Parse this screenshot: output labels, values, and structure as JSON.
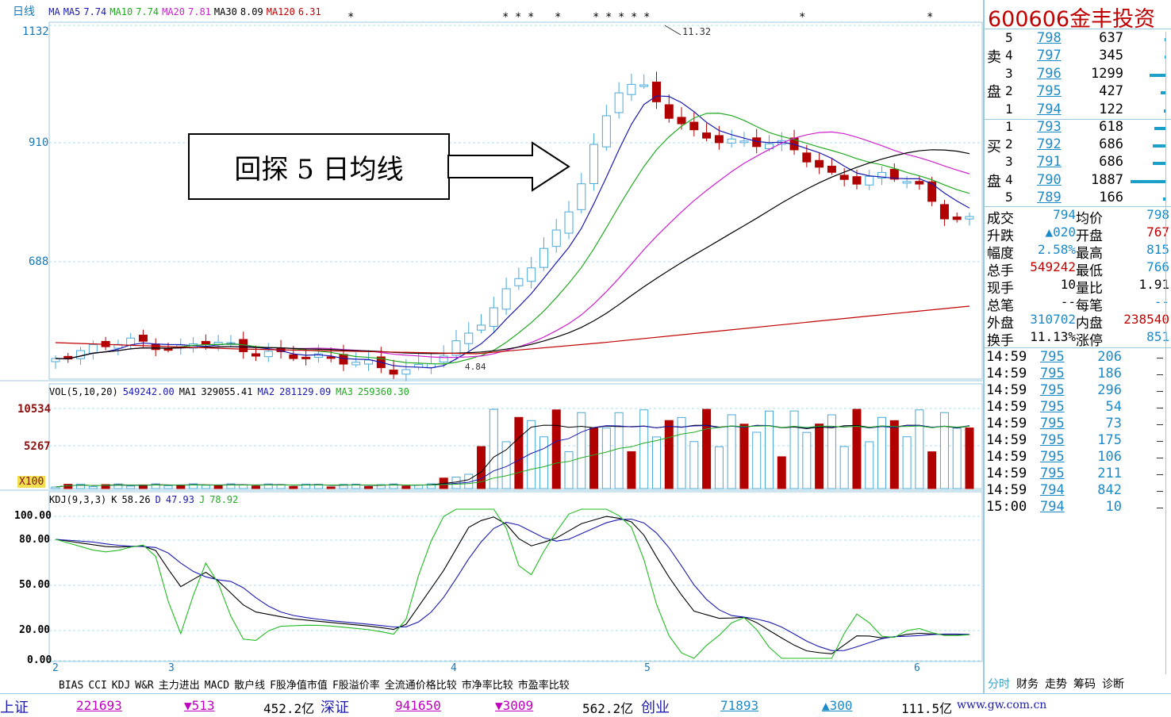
{
  "main_chart": {
    "period_label": "日线",
    "ma_legend": [
      {
        "label": "MA",
        "color": "#1a1ab0"
      },
      {
        "label": "MA5",
        "color": "#1a1ab0",
        "value": "7.74"
      },
      {
        "label": "MA10",
        "color": "#22aa22",
        "value": "7.74"
      },
      {
        "label": "MA20",
        "color": "#cc22cc",
        "value": "7.81"
      },
      {
        "label": "MA30",
        "color": "#000000",
        "value": "8.09"
      },
      {
        "label": "MA120",
        "color": "#c00000",
        "value": "6.31"
      }
    ],
    "y_ticks": [
      "1132",
      "910",
      "688"
    ],
    "high_marker": "11.32",
    "low_marker": "4.84",
    "annotation_text": "回探 5 日均线",
    "x_ticks": [
      "2",
      "3",
      "4",
      "5",
      "6"
    ]
  },
  "volume_chart": {
    "legend": [
      {
        "text": "VOL(5,10,20)",
        "color": "#000000"
      },
      {
        "text": "549242.00",
        "color": "#1a1ab0"
      },
      {
        "text": "MA1",
        "color": "#000000"
      },
      {
        "text": "329055.41",
        "color": "#000000"
      },
      {
        "text": "MA2",
        "color": "#1a1ab0"
      },
      {
        "text": "281129.09",
        "color": "#1a1ab0"
      },
      {
        "text": "MA3",
        "color": "#22aa22"
      },
      {
        "text": "259360.30",
        "color": "#22aa22"
      }
    ],
    "y_ticks": [
      "10534",
      "5267"
    ],
    "unit": "X100"
  },
  "kdj_chart": {
    "legend": [
      {
        "text": "KDJ(9,3,3)",
        "color": "#000000"
      },
      {
        "text": "K",
        "color": "#000000"
      },
      {
        "text": "58.26",
        "color": "#000000"
      },
      {
        "text": "D",
        "color": "#1a1ab0"
      },
      {
        "text": "47.93",
        "color": "#1a1ab0"
      },
      {
        "text": "J",
        "color": "#22aa22"
      },
      {
        "text": "78.92",
        "color": "#22aa22"
      }
    ],
    "y_ticks": [
      "100.00",
      "80.00",
      "50.00",
      "20.00",
      "0.00"
    ]
  },
  "indicator_tabs": [
    "BIAS",
    "CCI",
    "KDJ",
    "W&R",
    "主力进出",
    "MACD",
    "散户线",
    "F股净值市值",
    "F股溢价率",
    "全流通价格比较",
    "市净率比较",
    "市盈率比较"
  ],
  "quote_panel": {
    "code": "600606",
    "name": "金丰投资",
    "sell_label_1": "卖",
    "sell_label_2": "盘",
    "buy_label_1": "买",
    "buy_label_2": "盘",
    "sell": [
      {
        "level": "5",
        "price": "798",
        "vol": "637",
        "bar": 0.02
      },
      {
        "level": "4",
        "price": "797",
        "vol": "345",
        "bar": 0.02
      },
      {
        "level": "3",
        "price": "796",
        "vol": "1299",
        "bar": 0.5
      },
      {
        "level": "2",
        "price": "795",
        "vol": "427",
        "bar": 0.15
      },
      {
        "level": "1",
        "price": "794",
        "vol": "122",
        "bar": 0.05
      }
    ],
    "buy": [
      {
        "level": "1",
        "price": "793",
        "vol": "618",
        "bar": 0.25
      },
      {
        "level": "2",
        "price": "792",
        "vol": "686",
        "bar": 0.28
      },
      {
        "level": "3",
        "price": "791",
        "vol": "686",
        "bar": 0.28
      },
      {
        "level": "4",
        "price": "790",
        "vol": "1887",
        "bar": 0.78
      },
      {
        "level": "5",
        "price": "789",
        "vol": "166",
        "bar": 0.05
      }
    ],
    "stats": [
      {
        "l1": "成交",
        "v1": "794",
        "l2": "均价",
        "v2": "798",
        "v1color": "#1a8ac9",
        "v2color": "#1a8ac9"
      },
      {
        "l1": "升跌",
        "v1": "▲020",
        "l2": "开盘",
        "v2": "767",
        "v1color": "#1a8ac9",
        "v2color": "#c00000"
      },
      {
        "l1": "幅度",
        "v1": "2.58%",
        "l2": "最高",
        "v2": "815",
        "v1color": "#1a8ac9",
        "v2color": "#1a8ac9"
      },
      {
        "l1": "总手",
        "v1": "549242",
        "l2": "最低",
        "v2": "766",
        "v1color": "#c00000",
        "v2color": "#1a8ac9"
      },
      {
        "l1": "现手",
        "v1": "10",
        "l2": "量比",
        "v2": "1.91",
        "v1color": "#000000",
        "v2color": "#000000"
      },
      {
        "l1": "总笔",
        "v1": "--",
        "l2": "每笔",
        "v2": "--",
        "v1color": "#000000",
        "v2color": "#1a8ac9"
      },
      {
        "l1": "外盘",
        "v1": "310702",
        "l2": "内盘",
        "v2": "238540",
        "v1color": "#1a8ac9",
        "v2color": "#c00000"
      },
      {
        "l1": "换手",
        "v1": "11.13%",
        "l2": "涨停",
        "v2": "851",
        "v1color": "#000000",
        "v2color": "#1a8ac9"
      }
    ],
    "ticks": [
      {
        "time": "14:59",
        "price": "795",
        "vol": "206"
      },
      {
        "time": "14:59",
        "price": "795",
        "vol": "186"
      },
      {
        "time": "14:59",
        "price": "795",
        "vol": "296"
      },
      {
        "time": "14:59",
        "price": "795",
        "vol": "54"
      },
      {
        "time": "14:59",
        "price": "795",
        "vol": "73"
      },
      {
        "time": "14:59",
        "price": "795",
        "vol": "175"
      },
      {
        "time": "14:59",
        "price": "795",
        "vol": "106"
      },
      {
        "time": "14:59",
        "price": "795",
        "vol": "211"
      },
      {
        "time": "14:59",
        "price": "794",
        "vol": "842"
      },
      {
        "time": "15:00",
        "price": "794",
        "vol": "10"
      }
    ],
    "bottom_tabs": [
      "分时",
      "财务",
      "走势",
      "筹码",
      "诊断"
    ]
  },
  "status_bar": {
    "items": [
      {
        "label": "上证",
        "value": "221693",
        "change": "▼513",
        "amount": "452.2亿"
      },
      {
        "label": "深证",
        "value": "941650",
        "change": "▼3009",
        "amount": "562.2亿"
      },
      {
        "label": "创业",
        "value": "71893",
        "change": "▲300",
        "amount": "111.5亿"
      }
    ],
    "website": "www.gw.com.cn"
  }
}
